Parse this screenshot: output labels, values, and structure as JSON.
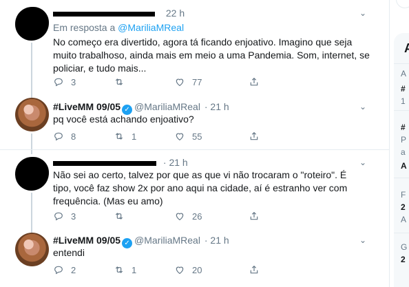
{
  "tweets": [
    {
      "time": "22 h",
      "reply_prefix": "Em resposta a ",
      "reply_handle": "@MariliaMReal",
      "text": "No começo era divertido, agora tá ficando enjoativo. Imagino que seja muito trabalhoso, ainda mais em meio a uma Pandemia. Som, internet, se policiar, e tudo mais...",
      "replies": "3",
      "retweets": "",
      "likes": "77"
    },
    {
      "name": "#LiveMM 09/05",
      "handle": "@MariliaMReal",
      "time": "· 21 h",
      "text": "pq você está achando enjoativo?",
      "replies": "8",
      "retweets": "1",
      "likes": "55"
    },
    {
      "time": "· 21 h",
      "text": "Não sei ao certo, talvez por que as que vi não trocaram o \"roteiro\". É tipo, você faz show 2x por ano aqui na cidade, aí é estranho ver com frequência. (Mas eu amo)",
      "replies": "3",
      "retweets": "",
      "likes": "26"
    },
    {
      "name": "#LiveMM 09/05",
      "handle": "@MariliaMReal",
      "time": "· 21 h",
      "text": "entendi",
      "replies": "2",
      "retweets": "1",
      "likes": "20"
    }
  ],
  "icons": {
    "reply": "reply-icon",
    "retweet": "retweet-icon",
    "like": "heart-icon",
    "share": "share-icon",
    "more": "chevron-down-icon",
    "verified": "verified-badge-icon"
  },
  "sidebar": {
    "heading": "A",
    "items": [
      "A",
      "#",
      "1",
      "#",
      "P",
      "a",
      "A",
      "F",
      "2",
      "A",
      "G",
      "2"
    ]
  },
  "colors": {
    "accent": "#1da1f2",
    "muted": "#657786",
    "text": "#14171a",
    "border": "#e6ecf0"
  }
}
